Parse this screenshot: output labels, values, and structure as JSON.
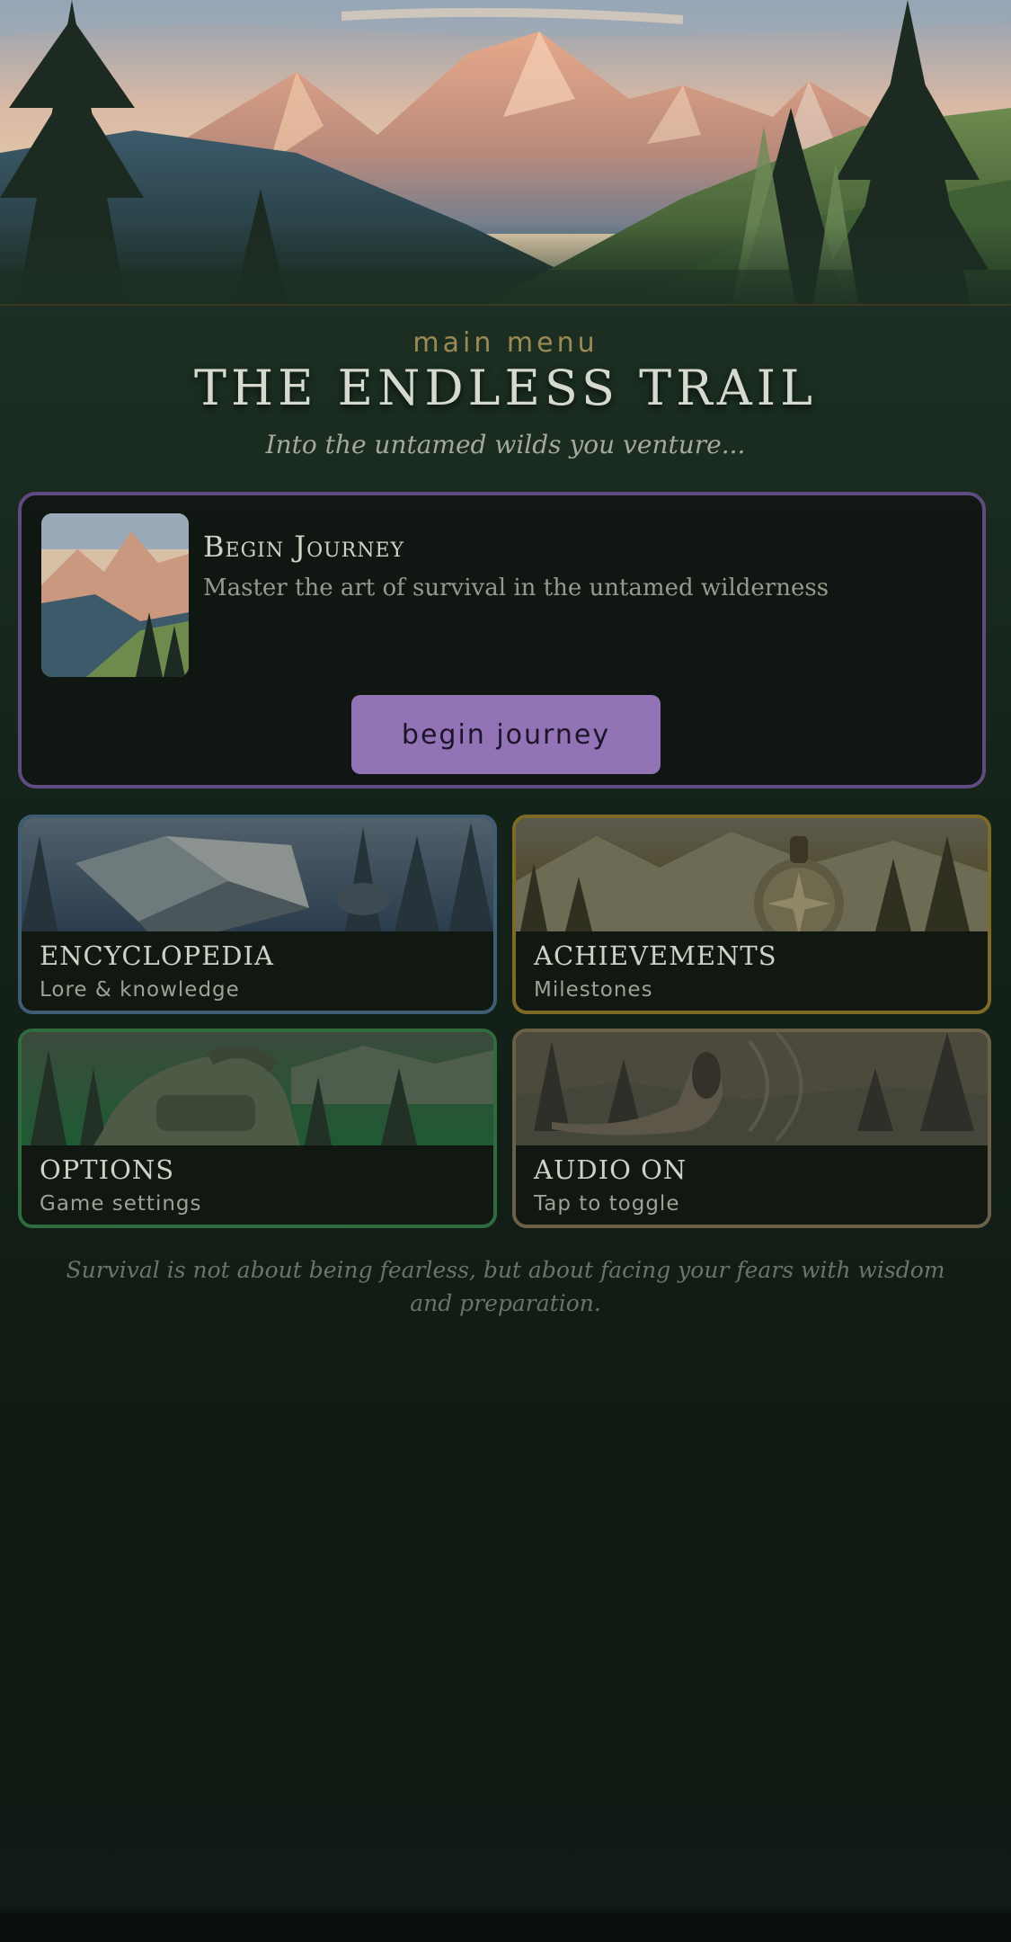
{
  "header": {
    "kicker": "main menu",
    "title": "THE ENDLESS TRAIL",
    "subtitle": "Into the untamed wilds you venture..."
  },
  "main_card": {
    "title": "Begin Journey",
    "description": "Master the art of survival in the untamed wilderness",
    "button_label": "begin journey",
    "accent_color": "#5f4b82",
    "button_color": "#9273b6"
  },
  "tiles": [
    {
      "title": "ENCYCLOPEDIA",
      "subtitle": "Lore & knowledge",
      "border_color": "#3f5c75",
      "art": "open-book-icon"
    },
    {
      "title": "ACHIEVEMENTS",
      "subtitle": "Milestones",
      "border_color": "#7d6a24",
      "art": "compass-medal-icon"
    },
    {
      "title": "OPTIONS",
      "subtitle": "Game settings",
      "border_color": "#2f6b3f",
      "art": "backpack-icon"
    },
    {
      "title": "AUDIO ON",
      "subtitle": "Tap to toggle",
      "border_color": "#6a5f47",
      "art": "horn-icon"
    }
  ],
  "quote": "Survival is not about being fearless, but about facing your fears with wisdom and preparation."
}
